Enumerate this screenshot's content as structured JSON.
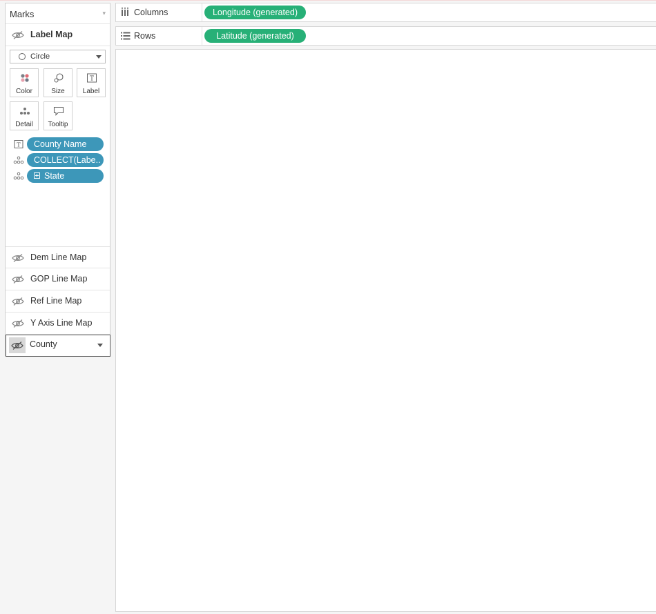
{
  "marks": {
    "title": "Marks",
    "active_layer": "Label Map",
    "mark_type": "Circle",
    "buttons": [
      {
        "label": "Color",
        "icon": "color-dots-icon"
      },
      {
        "label": "Size",
        "icon": "size-shapes-icon"
      },
      {
        "label": "Label",
        "icon": "label-text-icon"
      },
      {
        "label": "Detail",
        "icon": "detail-dots-icon"
      },
      {
        "label": "Tooltip",
        "icon": "tooltip-bubble-icon"
      }
    ],
    "fields": [
      {
        "encoding": "label-text-icon",
        "name": "County Name"
      },
      {
        "encoding": "detail-dots-icon",
        "name": "COLLECT(Labe.."
      },
      {
        "encoding": "detail-dots-icon",
        "name": "State"
      }
    ],
    "layers": [
      "Dem Line Map",
      "GOP Line Map",
      "Ref Line Map",
      "Y Axis Line Map"
    ],
    "selected_layer": "County"
  },
  "shelves": {
    "columns": {
      "label": "Columns",
      "pill": "Longitude (generated)"
    },
    "rows": {
      "label": "Rows",
      "pill": "Latitude (generated)"
    }
  },
  "colors": {
    "dimension_pill": "#3d97b9",
    "measure_pill": "#27b077"
  }
}
